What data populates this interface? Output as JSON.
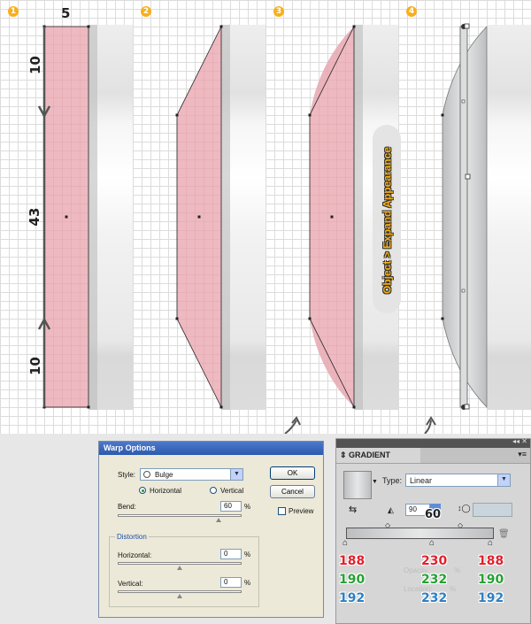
{
  "steps": [
    "1",
    "2",
    "3",
    "4"
  ],
  "dimensions": {
    "top": "5",
    "upper": "10",
    "middle": "43",
    "lower": "10"
  },
  "menu_command": "Object > Expand Appearance",
  "warp_options": {
    "title": "Warp Options",
    "style_label": "Style:",
    "style_value": "Bulge",
    "orientation_horizontal": "Horizontal",
    "orientation_vertical": "Vertical",
    "bend_label": "Bend:",
    "bend_value": "60",
    "percent": "%",
    "distortion_label": "Distortion",
    "horizontal_label": "Horizontal:",
    "horizontal_value": "0",
    "vertical_label": "Vertical:",
    "vertical_value": "0",
    "ok_label": "OK",
    "cancel_label": "Cancel",
    "preview_label": "Preview"
  },
  "gradient_panel": {
    "tab_label": "GRADIENT",
    "type_label": "Type:",
    "type_value": "Linear",
    "angle_value": "90",
    "angle_callout": "60",
    "opacity_label": "Opacity:",
    "location_label": "Location:",
    "percent": "%",
    "stops": [
      {
        "r": "188",
        "g": "190",
        "b": "192"
      },
      {
        "r": "230",
        "g": "232",
        "b": "232"
      },
      {
        "r": "188",
        "g": "190",
        "b": "192"
      }
    ]
  },
  "colors": {
    "shape_fill": "#eeb9c0",
    "badge": "#f6b01c",
    "red": "#e3202c",
    "green": "#27a133",
    "blue": "#2f7fc2"
  }
}
